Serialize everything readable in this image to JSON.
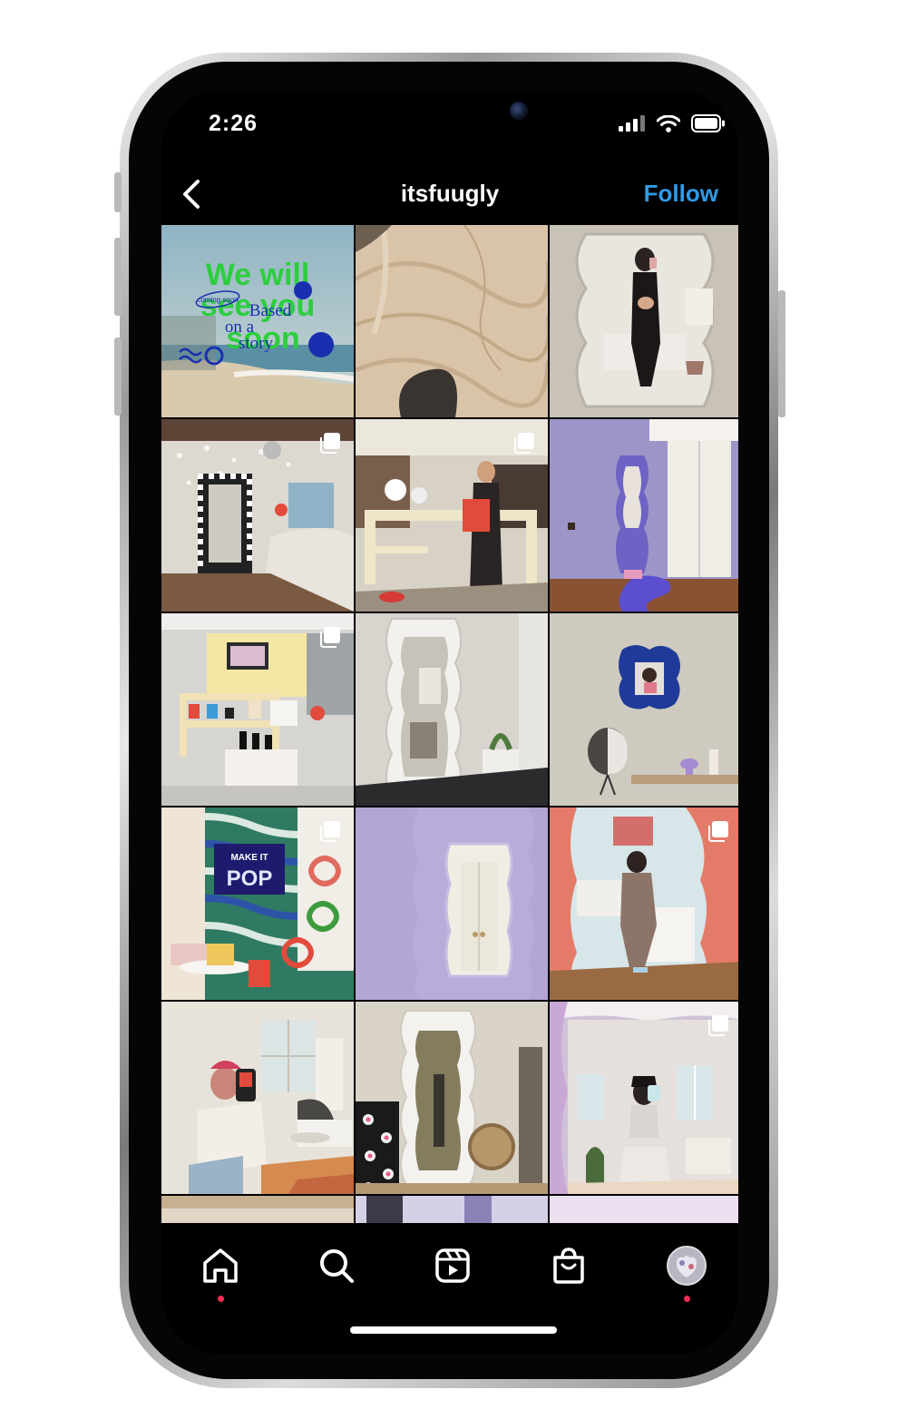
{
  "status_bar": {
    "time": "2:26"
  },
  "header": {
    "username": "itsfuugly",
    "follow_label": "Follow"
  },
  "colors": {
    "follow_blue": "#2e9be8",
    "background": "#000000",
    "notification_dot": "#ff2d55"
  },
  "posts": [
    {
      "subject": "coming-soon-graphic",
      "multi": false
    },
    {
      "subject": "wood-texture",
      "multi": false
    },
    {
      "subject": "mirror-selfie",
      "multi": false
    },
    {
      "subject": "checker-mirror-room",
      "multi": true
    },
    {
      "subject": "store-person",
      "multi": true
    },
    {
      "subject": "purple-room-mirror",
      "multi": false
    },
    {
      "subject": "store-display",
      "multi": true
    },
    {
      "subject": "white-wavy-mirror",
      "multi": false
    },
    {
      "subject": "blue-frame-wall",
      "multi": false
    },
    {
      "subject": "popup-store",
      "multi": true
    },
    {
      "subject": "lilac-mirror",
      "multi": false
    },
    {
      "subject": "pink-mirror-girl",
      "multi": true
    },
    {
      "subject": "phone-selfie",
      "multi": false
    },
    {
      "subject": "white-mirror-flowers",
      "multi": false
    },
    {
      "subject": "pink-room-selfie",
      "multi": true
    }
  ],
  "graphic_post": {
    "headline_line1": "We will",
    "headline_line2": "see you",
    "headline_line3": "soon",
    "overlay_line1": "Based",
    "overlay_line2": "on a",
    "overlay_line3": "story",
    "stamp": "coming soon"
  },
  "popup_post": {
    "sign_line1": "MAKE IT",
    "sign_line2": "POP"
  },
  "bottom_nav": {
    "items": [
      {
        "icon": "home-icon",
        "active": true
      },
      {
        "icon": "search-icon",
        "active": false
      },
      {
        "icon": "reels-icon",
        "active": false
      },
      {
        "icon": "shop-icon",
        "active": false
      },
      {
        "icon": "profile-avatar",
        "active": true
      }
    ]
  }
}
